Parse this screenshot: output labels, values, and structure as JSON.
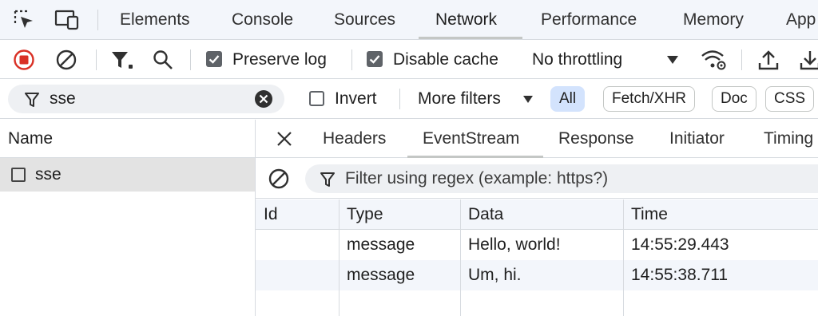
{
  "tabs": [
    "Elements",
    "Console",
    "Sources",
    "Network",
    "Performance",
    "Memory",
    "App"
  ],
  "active_tab": "Network",
  "toolbar": {
    "preserve_log": "Preserve log",
    "disable_cache": "Disable cache",
    "throttling": "No throttling"
  },
  "filter": {
    "value": "sse",
    "invert": "Invert",
    "more_filters": "More filters",
    "types": [
      "All",
      "Fetch/XHR",
      "Doc",
      "CSS"
    ]
  },
  "requests": {
    "header": "Name",
    "items": [
      "sse"
    ]
  },
  "detail": {
    "tabs": [
      "Headers",
      "EventStream",
      "Response",
      "Initiator",
      "Timing"
    ],
    "active_tab": "EventStream",
    "regex_placeholder": "Filter using regex (example: https?)",
    "columns": [
      "Id",
      "Type",
      "Data",
      "Time"
    ],
    "rows": [
      {
        "id": "",
        "type": "message",
        "data": "Hello, world!",
        "time": "14:55:29.443"
      },
      {
        "id": "",
        "type": "message",
        "data": "Um, hi.",
        "time": "14:55:38.711"
      }
    ]
  },
  "colors": {
    "record_red": "#d93025",
    "selected_row": "#e3e3e3",
    "active_pill": "#d3e3fd"
  }
}
